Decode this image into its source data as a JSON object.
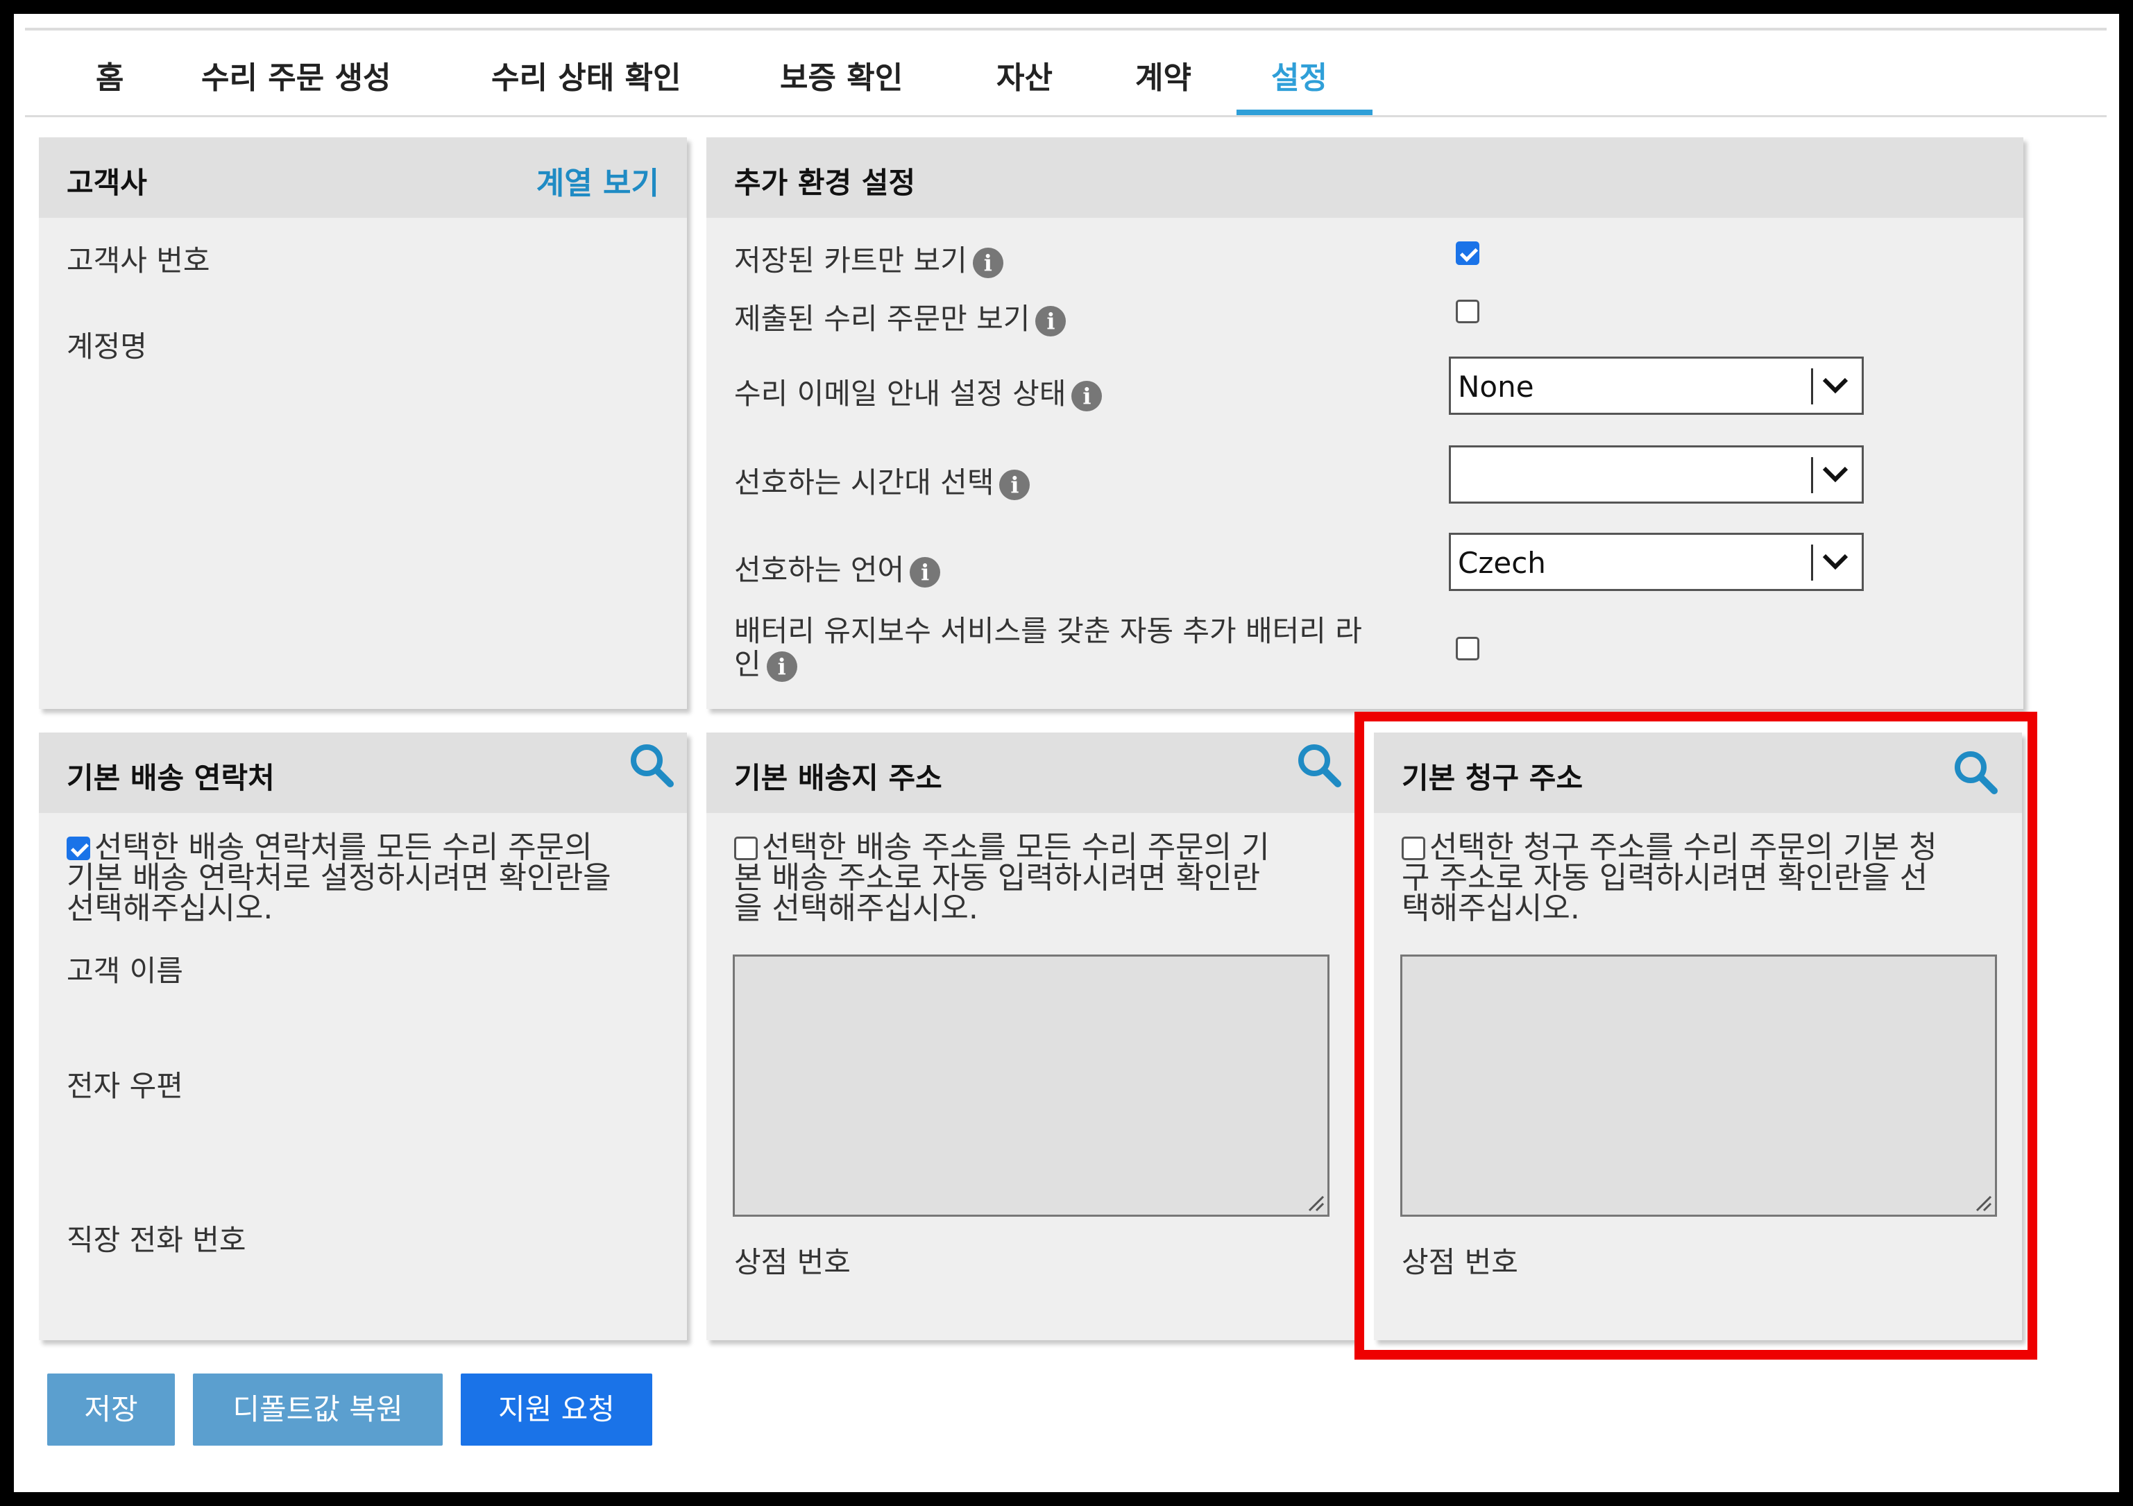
{
  "nav": {
    "tabs": [
      {
        "label": "홈"
      },
      {
        "label": "수리 주문 생성"
      },
      {
        "label": "수리 상태 확인"
      },
      {
        "label": "보증 확인"
      },
      {
        "label": "자산"
      },
      {
        "label": "계약"
      },
      {
        "label": "설정",
        "active": true
      }
    ]
  },
  "customer": {
    "title": "고객사",
    "link": "계열 보기",
    "fields": [
      "고객사 번호",
      "계정명"
    ]
  },
  "settings": {
    "title": "추가 환경 설정",
    "rows": [
      {
        "label": "저장된 카트만 보기",
        "type": "checkbox",
        "checked": true
      },
      {
        "label": "제출된 수리 주문만 보기",
        "type": "checkbox",
        "checked": false
      },
      {
        "label": "수리 이메일 안내 설정 상태",
        "type": "select",
        "value": "None"
      },
      {
        "label": "선호하는 시간대 선택",
        "type": "select",
        "value": ""
      },
      {
        "label": "선호하는 언어",
        "type": "select",
        "value": "Czech"
      },
      {
        "label_line1": "배터리 유지보수 서비스를 갖춘 자동 추가 배터리 라",
        "label_line2": "인",
        "type": "checkbox",
        "checked": false
      }
    ]
  },
  "shipping_contact": {
    "title": "기본 배송 연락처",
    "checkbox_checked": true,
    "desc_lines": [
      "선택한 배송 연락처를 모든 수리 주문의",
      "기본 배송 연락처로 설정하시려면 확인란을",
      "선택해주십시오."
    ],
    "fields": [
      "고객 이름",
      "전자 우편",
      "직장 전화 번호"
    ]
  },
  "shipping_address": {
    "title": "기본 배송지 주소",
    "checkbox_checked": false,
    "desc_lines": [
      "선택한 배송 주소를 모든 수리 주문의 기",
      "본 배송 주소로 자동 입력하시려면 확인란",
      "을 선택해주십시오."
    ],
    "store_label": "상점 번호"
  },
  "billing_address": {
    "title": "기본 청구 주소",
    "checkbox_checked": false,
    "desc_lines": [
      "선택한 청구 주소를 수리 주문의 기본 청",
      "구 주소로 자동 입력하시려면 확인란을 선",
      "택해주십시오."
    ],
    "store_label": "상점 번호"
  },
  "buttons": {
    "save": "저장",
    "restore": "디폴트값 복원",
    "support": "지원 요청"
  },
  "colors": {
    "accent": "#2f9fd8",
    "button_muted": "#5b9fcf",
    "button_primary": "#1a73e8",
    "highlight": "#ee0000"
  }
}
